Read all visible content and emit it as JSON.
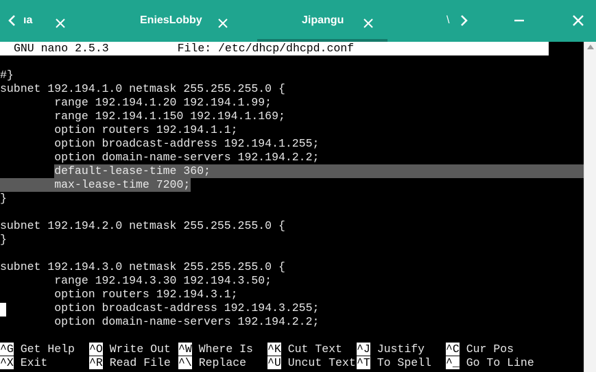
{
  "titlebar": {
    "tabs": [
      {
        "label": "ıa",
        "active": false
      },
      {
        "label": "EniesLobby",
        "active": false
      },
      {
        "label": "Jipangu",
        "active": true
      },
      {
        "label": "\\",
        "active": false
      }
    ],
    "colors": {
      "bar": "#1fa58f",
      "active_underline": "#147a6a"
    }
  },
  "nano": {
    "version": "GNU nano 2.5.3",
    "file_label": "File: /etc/dhcp/dhcpd.conf"
  },
  "content": {
    "lines": [
      "#}",
      "subnet 192.194.1.0 netmask 255.255.255.0 {",
      "        range 192.194.1.20 192.194.1.99;",
      "        range 192.194.1.150 192.194.1.169;",
      "        option routers 192.194.1.1;",
      "        option broadcast-address 192.194.1.255;",
      "        option domain-name-servers 192.194.2.2;",
      "        default-lease-time 360;",
      "        max-lease-time 7200;",
      "}",
      "",
      "subnet 192.194.2.0 netmask 255.255.255.0 {",
      "}",
      "",
      "subnet 192.194.3.0 netmask 255.255.255.0 {",
      "        range 192.194.3.30 192.194.3.50;",
      "        option routers 192.194.3.1;",
      "        option broadcast-address 192.194.3.255;",
      "        option domain-name-servers 192.194.2.2;"
    ]
  },
  "shortcuts": [
    {
      "key": "^G",
      "label": "Get Help"
    },
    {
      "key": "^O",
      "label": "Write Out"
    },
    {
      "key": "^W",
      "label": "Where Is"
    },
    {
      "key": "^K",
      "label": "Cut Text"
    },
    {
      "key": "^J",
      "label": "Justify"
    },
    {
      "key": "^C",
      "label": "Cur Pos"
    },
    {
      "key": "^X",
      "label": "Exit"
    },
    {
      "key": "^R",
      "label": "Read File"
    },
    {
      "key": "^\\",
      "label": "Replace"
    },
    {
      "key": "^U",
      "label": "Uncut Text"
    },
    {
      "key": "^T",
      "label": "To Spell"
    },
    {
      "key": "^_",
      "label": "Go To Line"
    }
  ],
  "icons": {
    "back": "chevron-left-icon",
    "forward": "chevron-right-icon",
    "minimize": "minimize-icon",
    "close": "close-icon",
    "tab_close": "close-icon"
  }
}
